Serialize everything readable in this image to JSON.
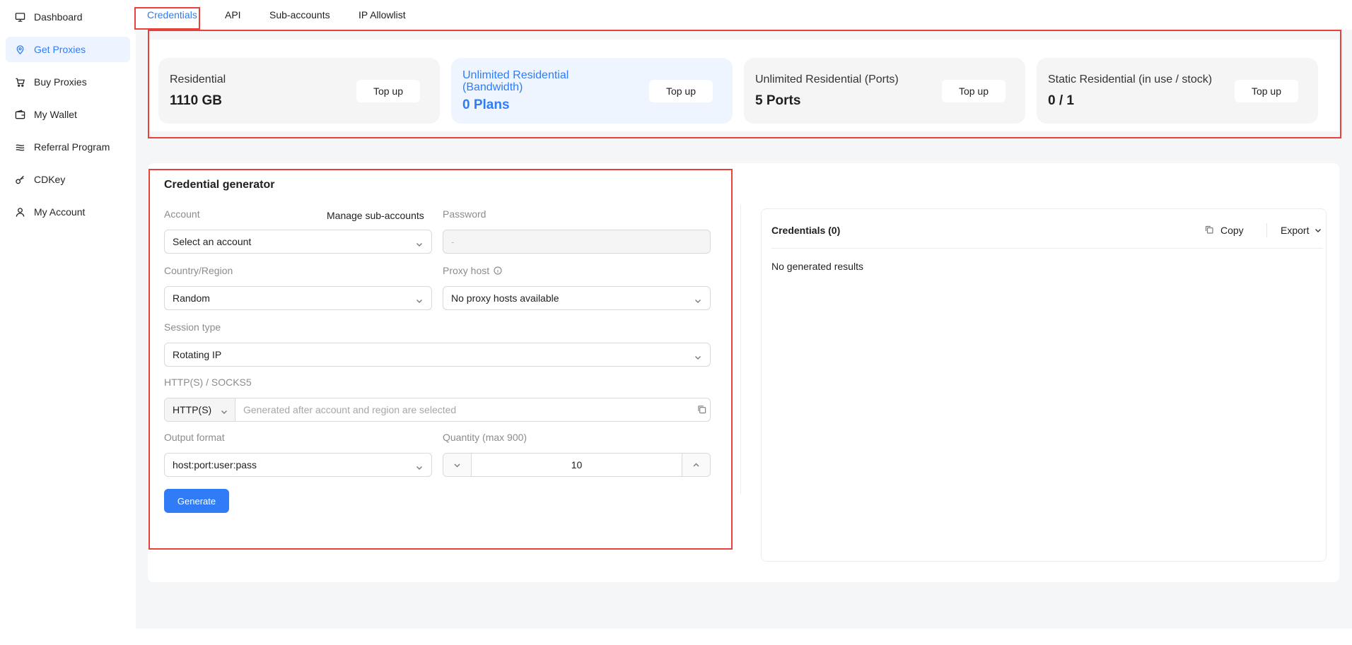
{
  "sidebar": {
    "items": [
      {
        "label": "Dashboard",
        "icon": "dashboard-icon"
      },
      {
        "label": "Get Proxies",
        "icon": "location-pin-icon",
        "active": true
      },
      {
        "label": "Buy Proxies",
        "icon": "cart-icon"
      },
      {
        "label": "My Wallet",
        "icon": "wallet-icon"
      },
      {
        "label": "Referral Program",
        "icon": "referral-icon"
      },
      {
        "label": "CDKey",
        "icon": "key-icon"
      },
      {
        "label": "My Account",
        "icon": "user-icon"
      }
    ]
  },
  "tabs": [
    {
      "label": "Credentials",
      "active": true
    },
    {
      "label": "API"
    },
    {
      "label": "Sub-accounts"
    },
    {
      "label": "IP Allowlist"
    }
  ],
  "stats": [
    {
      "title": "Residential",
      "value": "1110 GB",
      "button": "Top up"
    },
    {
      "title": "Unlimited Residential (Bandwidth)",
      "value": "0 Plans",
      "button": "Top up",
      "highlighted": true
    },
    {
      "title": "Unlimited Residential (Ports)",
      "value": "5 Ports",
      "button": "Top up"
    },
    {
      "title": "Static Residential (in use / stock)",
      "value": "0 / 1",
      "button": "Top up"
    }
  ],
  "generator": {
    "title": "Credential generator",
    "account_label": "Account",
    "manage_link": "Manage sub-accounts",
    "account_value": "Select an account",
    "password_label": "Password",
    "password_value": "-",
    "country_label": "Country/Region",
    "country_value": "Random",
    "proxy_host_label": "Proxy host",
    "proxy_host_value": "No proxy hosts available",
    "session_label": "Session type",
    "session_value": "Rotating IP",
    "protocol_label": "HTTP(S) / SOCKS5",
    "protocol_value": "HTTP(S)",
    "endpoint_placeholder": "Generated after account and region are selected",
    "output_label": "Output format",
    "output_value": "host:port:user:pass",
    "quantity_label": "Quantity (max 900)",
    "quantity_value": "10",
    "generate_button": "Generate"
  },
  "credentials": {
    "title": "Credentials (0)",
    "copy_label": "Copy",
    "export_label": "Export",
    "empty_text": "No generated results"
  },
  "colors": {
    "accent": "#2f7cf6",
    "highlight_border": "#e8403a",
    "page_bg": "#f5f6f8"
  }
}
